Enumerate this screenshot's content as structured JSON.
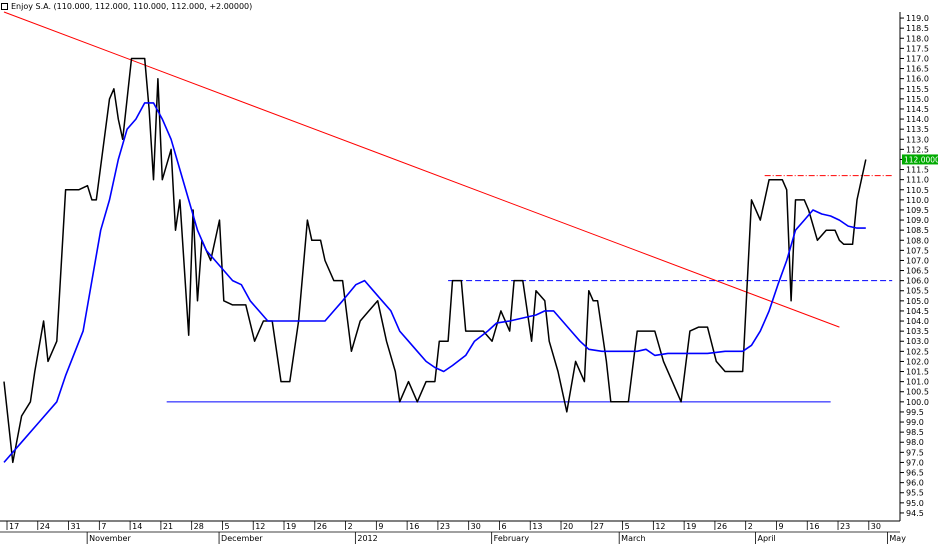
{
  "window": {
    "title": "Enjoy S.A. (110.000, 112.000, 110.000, 112.000, +2.00000)"
  },
  "colors": {
    "price": "#000000",
    "moving_average": "#0000ff",
    "trendline": "#ff0000",
    "support": "#0000ff",
    "resistance_dashed": "#0000ff",
    "level_dashdot": "#ff0000",
    "last_price_badge": "#00aa00",
    "axis": "#000000"
  },
  "chart_data": {
    "type": "line",
    "title": "Enjoy S.A. (110.000, 112.000, 110.000, 112.000, +2.00000)",
    "xlabel": "",
    "ylabel": "",
    "x_range": [
      "2011-11-14",
      "2012-05-05"
    ],
    "ylim": [
      94.2,
      119.3
    ],
    "y_ticks": [
      94.5,
      95.0,
      95.5,
      96.0,
      96.5,
      97.0,
      97.5,
      98.0,
      98.5,
      99.0,
      99.5,
      100.0,
      100.5,
      101.0,
      101.5,
      102.0,
      102.5,
      103.0,
      103.5,
      104.0,
      104.5,
      105.0,
      105.5,
      106.0,
      106.5,
      107.0,
      107.5,
      108.0,
      108.5,
      109.0,
      109.5,
      110.0,
      110.5,
      111.0,
      111.5,
      112.0,
      112.5,
      113.0,
      113.5,
      114.0,
      114.5,
      115.0,
      115.5,
      116.0,
      116.5,
      117.0,
      117.5,
      118.0,
      118.5,
      119.0
    ],
    "x_day_ticks": [
      {
        "date": "2011-11-17",
        "label": "17"
      },
      {
        "date": "2011-11-24",
        "label": "24"
      },
      {
        "date": "2011-10-31",
        "label": "31"
      },
      {
        "date": "2011-11-07",
        "label": "7"
      },
      {
        "date": "2011-11-14",
        "label": "14"
      },
      {
        "date": "2011-11-21",
        "label": "21"
      },
      {
        "date": "2011-11-28",
        "label": "28"
      },
      {
        "date": "2011-12-05",
        "label": "5"
      },
      {
        "date": "2011-12-12",
        "label": "12"
      },
      {
        "date": "2011-12-19",
        "label": "19"
      },
      {
        "date": "2011-12-26",
        "label": "26"
      },
      {
        "date": "2012-01-02",
        "label": "2"
      },
      {
        "date": "2012-01-09",
        "label": "9"
      },
      {
        "date": "2012-01-16",
        "label": "16"
      },
      {
        "date": "2012-01-23",
        "label": "23"
      },
      {
        "date": "2012-01-30",
        "label": "30"
      },
      {
        "date": "2012-02-06",
        "label": "6"
      },
      {
        "date": "2012-02-13",
        "label": "13"
      },
      {
        "date": "2012-02-20",
        "label": "20"
      },
      {
        "date": "2012-02-27",
        "label": "27"
      },
      {
        "date": "2012-03-05",
        "label": "5"
      },
      {
        "date": "2012-03-12",
        "label": "12"
      },
      {
        "date": "2012-03-19",
        "label": "19"
      },
      {
        "date": "2012-03-26",
        "label": "26"
      },
      {
        "date": "2012-04-02",
        "label": "2"
      },
      {
        "date": "2012-04-09",
        "label": "9"
      },
      {
        "date": "2012-04-16",
        "label": "16"
      },
      {
        "date": "2012-04-23",
        "label": "23"
      },
      {
        "date": "2012-04-30",
        "label": "30"
      }
    ],
    "x_month_ticks": [
      {
        "date": "2011-11-01",
        "label": "November"
      },
      {
        "date": "2011-12-01",
        "label": "December"
      },
      {
        "date": "2012-01-01",
        "label": "2012"
      },
      {
        "date": "2012-02-01",
        "label": "February"
      },
      {
        "date": "2012-03-01",
        "label": "March"
      },
      {
        "date": "2012-04-01",
        "label": "April"
      },
      {
        "date": "2012-05-01",
        "label": "May"
      }
    ],
    "series": [
      {
        "role": "price",
        "points": [
          [
            "2011-10-14",
            101.0
          ],
          [
            "2011-10-16",
            97.0
          ],
          [
            "2011-10-18",
            99.3
          ],
          [
            "2011-10-20",
            100.0
          ],
          [
            "2011-10-21",
            101.5
          ],
          [
            "2011-10-23",
            104.0
          ],
          [
            "2011-10-24",
            102.0
          ],
          [
            "2011-10-26",
            103.0
          ],
          [
            "2011-10-28",
            110.5
          ],
          [
            "2011-10-30",
            110.5
          ],
          [
            "2011-10-31",
            110.5
          ],
          [
            "2011-11-02",
            110.7
          ],
          [
            "2011-11-03",
            110.0
          ],
          [
            "2011-11-04",
            110.0
          ],
          [
            "2011-11-07",
            115.0
          ],
          [
            "2011-11-08",
            115.5
          ],
          [
            "2011-11-09",
            114.0
          ],
          [
            "2011-11-10",
            113.0
          ],
          [
            "2011-11-12",
            117.0
          ],
          [
            "2011-11-14",
            117.0
          ],
          [
            "2011-11-15",
            117.0
          ],
          [
            "2011-11-16",
            114.5
          ],
          [
            "2011-11-17",
            111.0
          ],
          [
            "2011-11-18",
            116.0
          ],
          [
            "2011-11-19",
            111.0
          ],
          [
            "2011-11-21",
            112.5
          ],
          [
            "2011-11-22",
            108.5
          ],
          [
            "2011-11-23",
            110.0
          ],
          [
            "2011-11-25",
            103.3
          ],
          [
            "2011-11-26",
            109.5
          ],
          [
            "2011-11-27",
            105.0
          ],
          [
            "2011-11-28",
            108.0
          ],
          [
            "2011-11-30",
            107.0
          ],
          [
            "2011-12-02",
            109.0
          ],
          [
            "2011-12-03",
            105.0
          ],
          [
            "2011-12-05",
            104.8
          ],
          [
            "2011-12-07",
            104.8
          ],
          [
            "2011-12-08",
            104.8
          ],
          [
            "2011-12-10",
            103.0
          ],
          [
            "2011-12-12",
            104.0
          ],
          [
            "2011-12-14",
            104.0
          ],
          [
            "2011-12-16",
            101.0
          ],
          [
            "2011-12-18",
            101.0
          ],
          [
            "2011-12-20",
            104.0
          ],
          [
            "2011-12-22",
            109.0
          ],
          [
            "2011-12-23",
            108.0
          ],
          [
            "2011-12-25",
            108.0
          ],
          [
            "2011-12-26",
            107.0
          ],
          [
            "2011-12-28",
            106.0
          ],
          [
            "2011-12-30",
            106.0
          ],
          [
            "2012-01-01",
            102.5
          ],
          [
            "2012-01-03",
            104.0
          ],
          [
            "2012-01-05",
            104.5
          ],
          [
            "2012-01-07",
            105.0
          ],
          [
            "2012-01-09",
            103.0
          ],
          [
            "2012-01-11",
            101.5
          ],
          [
            "2012-01-12",
            100.0
          ],
          [
            "2012-01-14",
            101.0
          ],
          [
            "2012-01-16",
            100.0
          ],
          [
            "2012-01-18",
            101.0
          ],
          [
            "2012-01-20",
            101.0
          ],
          [
            "2012-01-21",
            103.0
          ],
          [
            "2012-01-23",
            103.0
          ],
          [
            "2012-01-24",
            106.0
          ],
          [
            "2012-01-26",
            106.0
          ],
          [
            "2012-01-27",
            103.5
          ],
          [
            "2012-01-29",
            103.5
          ],
          [
            "2012-01-31",
            103.5
          ],
          [
            "2012-02-02",
            103.0
          ],
          [
            "2012-02-04",
            104.5
          ],
          [
            "2012-02-06",
            103.5
          ],
          [
            "2012-02-07",
            106.0
          ],
          [
            "2012-02-09",
            106.0
          ],
          [
            "2012-02-11",
            103.0
          ],
          [
            "2012-02-12",
            105.5
          ],
          [
            "2012-02-14",
            105.0
          ],
          [
            "2012-02-15",
            103.0
          ],
          [
            "2012-02-17",
            101.5
          ],
          [
            "2012-02-19",
            99.5
          ],
          [
            "2012-02-21",
            102.0
          ],
          [
            "2012-02-23",
            101.0
          ],
          [
            "2012-02-24",
            105.5
          ],
          [
            "2012-02-25",
            105.0
          ],
          [
            "2012-02-26",
            105.0
          ],
          [
            "2012-02-28",
            102.0
          ],
          [
            "2012-02-29",
            100.0
          ],
          [
            "2012-03-02",
            100.0
          ],
          [
            "2012-03-04",
            100.0
          ],
          [
            "2012-03-06",
            103.5
          ],
          [
            "2012-03-08",
            103.5
          ],
          [
            "2012-03-10",
            103.5
          ],
          [
            "2012-03-12",
            102.0
          ],
          [
            "2012-03-14",
            101.0
          ],
          [
            "2012-03-16",
            100.0
          ],
          [
            "2012-03-18",
            103.5
          ],
          [
            "2012-03-20",
            103.7
          ],
          [
            "2012-03-22",
            103.7
          ],
          [
            "2012-03-24",
            102.0
          ],
          [
            "2012-03-26",
            101.5
          ],
          [
            "2012-03-28",
            101.5
          ],
          [
            "2012-03-30",
            101.5
          ],
          [
            "2012-04-01",
            110.0
          ],
          [
            "2012-04-03",
            109.0
          ],
          [
            "2012-04-05",
            111.0
          ],
          [
            "2012-04-07",
            111.0
          ],
          [
            "2012-04-08",
            111.0
          ],
          [
            "2012-04-09",
            110.5
          ],
          [
            "2012-04-10",
            105.0
          ],
          [
            "2012-04-11",
            110.0
          ],
          [
            "2012-04-13",
            110.0
          ],
          [
            "2012-04-14",
            109.5
          ],
          [
            "2012-04-16",
            108.0
          ],
          [
            "2012-04-18",
            108.5
          ],
          [
            "2012-04-20",
            108.5
          ],
          [
            "2012-04-21",
            108.0
          ],
          [
            "2012-04-22",
            107.8
          ],
          [
            "2012-04-24",
            107.8
          ],
          [
            "2012-04-25",
            110.0
          ],
          [
            "2012-04-27",
            112.0
          ]
        ]
      },
      {
        "role": "moving-average",
        "points": [
          [
            "2011-10-14",
            97.0
          ],
          [
            "2011-10-18",
            98.0
          ],
          [
            "2011-10-22",
            99.0
          ],
          [
            "2011-10-26",
            100.0
          ],
          [
            "2011-10-28",
            101.3
          ],
          [
            "2011-11-01",
            103.5
          ],
          [
            "2011-11-03",
            106.0
          ],
          [
            "2011-11-05",
            108.5
          ],
          [
            "2011-11-07",
            110.0
          ],
          [
            "2011-11-09",
            112.0
          ],
          [
            "2011-11-11",
            113.5
          ],
          [
            "2011-11-13",
            114.0
          ],
          [
            "2011-11-15",
            114.8
          ],
          [
            "2011-11-17",
            114.8
          ],
          [
            "2011-11-19",
            114.0
          ],
          [
            "2011-11-21",
            113.0
          ],
          [
            "2011-11-23",
            111.5
          ],
          [
            "2011-11-25",
            110.0
          ],
          [
            "2011-11-27",
            108.5
          ],
          [
            "2011-11-29",
            107.5
          ],
          [
            "2011-12-01",
            107.0
          ],
          [
            "2011-12-03",
            106.5
          ],
          [
            "2011-12-05",
            106.0
          ],
          [
            "2011-12-07",
            105.8
          ],
          [
            "2011-12-09",
            105.0
          ],
          [
            "2011-12-11",
            104.5
          ],
          [
            "2011-12-13",
            104.0
          ],
          [
            "2011-12-15",
            104.0
          ],
          [
            "2011-12-17",
            104.0
          ],
          [
            "2011-12-19",
            104.0
          ],
          [
            "2011-12-22",
            104.0
          ],
          [
            "2011-12-24",
            104.0
          ],
          [
            "2011-12-26",
            104.0
          ],
          [
            "2011-12-28",
            104.5
          ],
          [
            "2011-12-30",
            105.0
          ],
          [
            "2012-01-02",
            105.8
          ],
          [
            "2012-01-04",
            106.0
          ],
          [
            "2012-01-06",
            105.5
          ],
          [
            "2012-01-08",
            105.0
          ],
          [
            "2012-01-10",
            104.5
          ],
          [
            "2012-01-12",
            103.5
          ],
          [
            "2012-01-14",
            103.0
          ],
          [
            "2012-01-16",
            102.5
          ],
          [
            "2012-01-18",
            102.0
          ],
          [
            "2012-01-20",
            101.7
          ],
          [
            "2012-01-22",
            101.5
          ],
          [
            "2012-01-24",
            101.8
          ],
          [
            "2012-01-27",
            102.3
          ],
          [
            "2012-01-29",
            103.0
          ],
          [
            "2012-02-01",
            103.5
          ],
          [
            "2012-02-03",
            103.9
          ],
          [
            "2012-02-06",
            104.0
          ],
          [
            "2012-02-08",
            104.1
          ],
          [
            "2012-02-10",
            104.2
          ],
          [
            "2012-02-12",
            104.3
          ],
          [
            "2012-02-14",
            104.5
          ],
          [
            "2012-02-16",
            104.5
          ],
          [
            "2012-02-18",
            104.0
          ],
          [
            "2012-02-20",
            103.5
          ],
          [
            "2012-02-22",
            103.0
          ],
          [
            "2012-02-24",
            102.6
          ],
          [
            "2012-02-27",
            102.5
          ],
          [
            "2012-03-02",
            102.5
          ],
          [
            "2012-03-06",
            102.5
          ],
          [
            "2012-03-08",
            102.6
          ],
          [
            "2012-03-10",
            102.3
          ],
          [
            "2012-03-13",
            102.4
          ],
          [
            "2012-03-18",
            102.4
          ],
          [
            "2012-03-22",
            102.4
          ],
          [
            "2012-03-26",
            102.5
          ],
          [
            "2012-03-30",
            102.5
          ],
          [
            "2012-04-01",
            102.8
          ],
          [
            "2012-04-03",
            103.5
          ],
          [
            "2012-04-05",
            104.5
          ],
          [
            "2012-04-07",
            105.8
          ],
          [
            "2012-04-09",
            107.0
          ],
          [
            "2012-04-11",
            108.5
          ],
          [
            "2012-04-13",
            109.0
          ],
          [
            "2012-04-15",
            109.5
          ],
          [
            "2012-04-17",
            109.3
          ],
          [
            "2012-04-19",
            109.2
          ],
          [
            "2012-04-21",
            109.0
          ],
          [
            "2012-04-23",
            108.7
          ],
          [
            "2012-04-25",
            108.6
          ],
          [
            "2012-04-27",
            108.6
          ]
        ]
      }
    ],
    "annotations": [
      {
        "kind": "trendline",
        "from": [
          "2011-10-14",
          119.3
        ],
        "to": [
          "2012-04-21",
          103.7
        ]
      },
      {
        "kind": "support",
        "from": [
          "2011-11-20",
          100.0
        ],
        "to": [
          "2012-04-19",
          100.0
        ],
        "style": "solid"
      },
      {
        "kind": "resistance",
        "from": [
          "2012-01-23",
          106.0
        ],
        "to": [
          "2012-05-03",
          106.0
        ],
        "style": "dashed"
      },
      {
        "kind": "level",
        "from": [
          "2012-04-04",
          111.2
        ],
        "to": [
          "2012-05-03",
          111.2
        ],
        "style": "dash-dot"
      }
    ],
    "last_price_label": "112.0000",
    "grid": false
  }
}
